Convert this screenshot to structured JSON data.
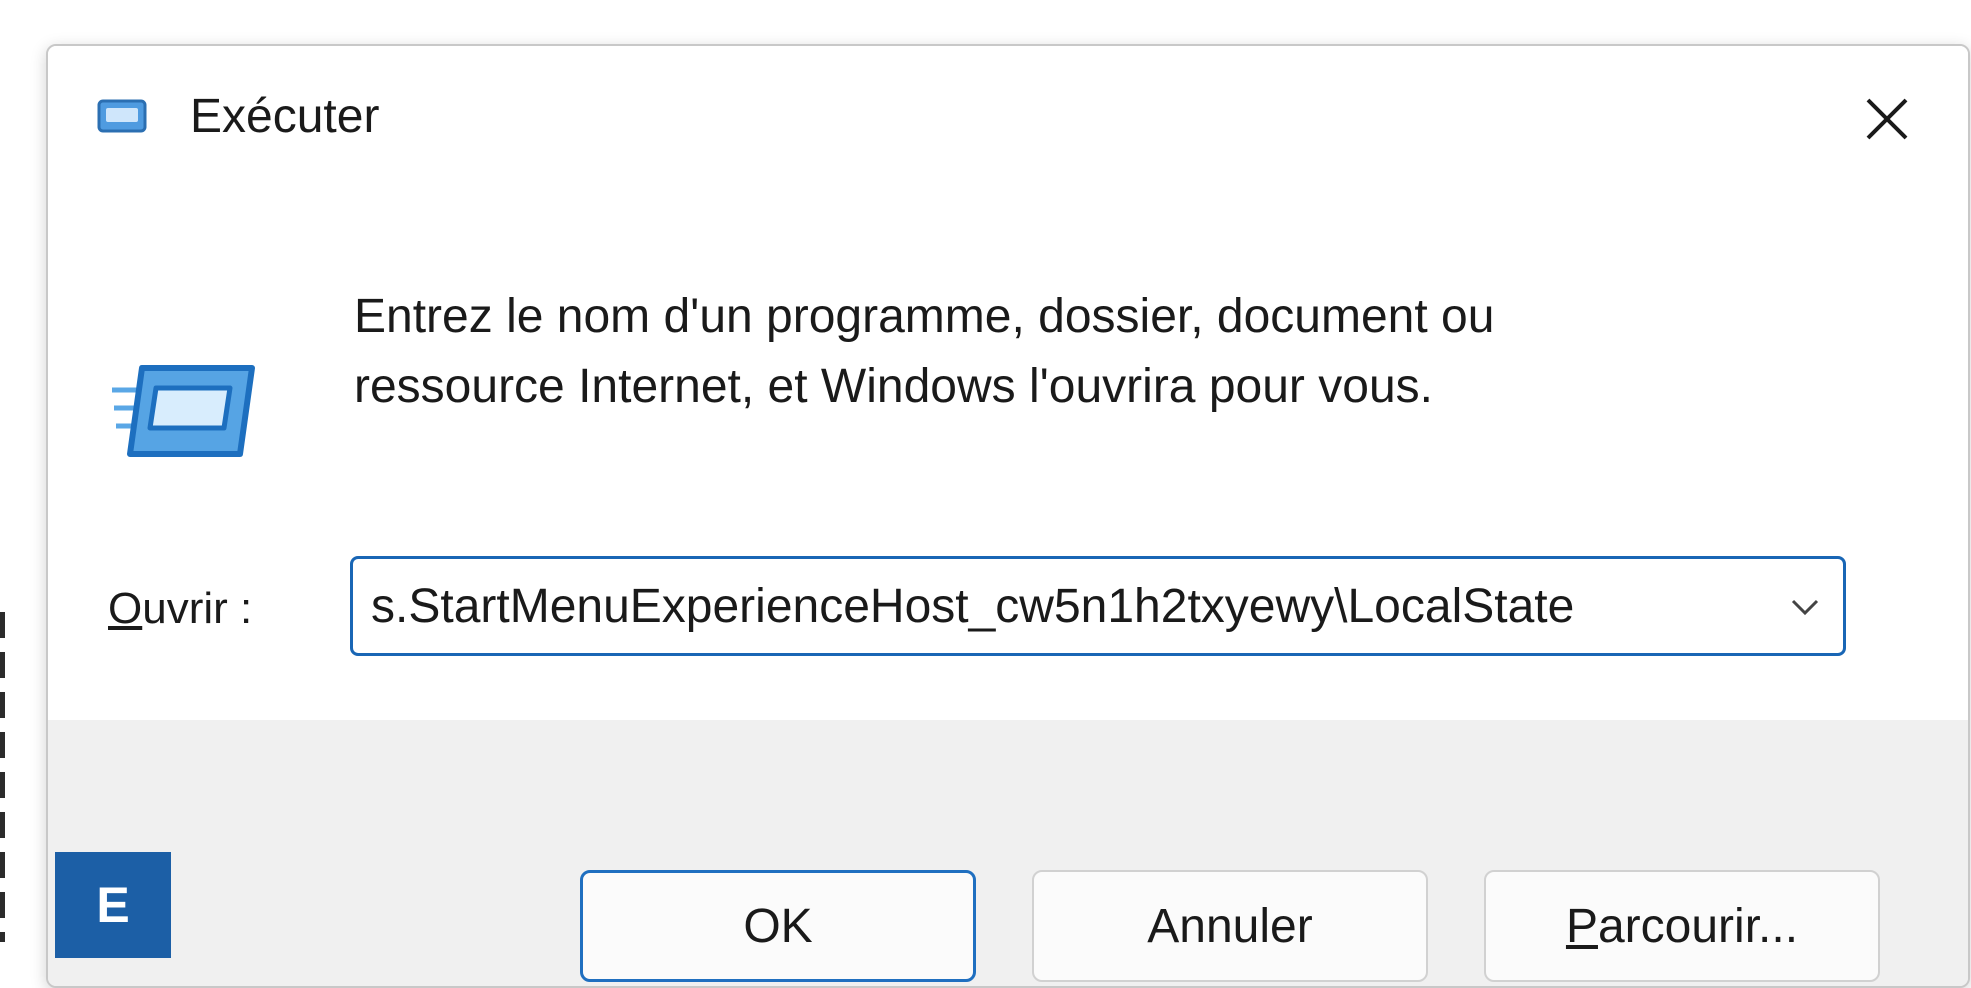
{
  "window": {
    "title": "Exécuter",
    "close_icon": "close-icon",
    "app_icon": "run-dialog-icon"
  },
  "content": {
    "description": "Entrez le nom d'un programme, dossier, document ou ressource Internet, et Windows l'ouvrira pour vous.",
    "description_line1": "Entrez le nom d'un programme, dossier, document ou",
    "description_line2": "ressource Internet, et Windows l'ouvrira pour vous.",
    "open_label_accel": "O",
    "open_label_rest": "uvrir :",
    "open_value": "s.StartMenuExperienceHost_cw5n1h2txyewy\\LocalState",
    "dropdown_icon": "chevron-down-icon"
  },
  "buttons": {
    "ok": "OK",
    "cancel": "Annuler",
    "browse_accel": "P",
    "browse_rest": "arcourir..."
  },
  "badge": {
    "letter": "E"
  },
  "colors": {
    "accent": "#1966b5",
    "badge": "#1c5fa6",
    "dialog_bg": "#ffffff",
    "footer_bg": "#f0f0f0"
  }
}
